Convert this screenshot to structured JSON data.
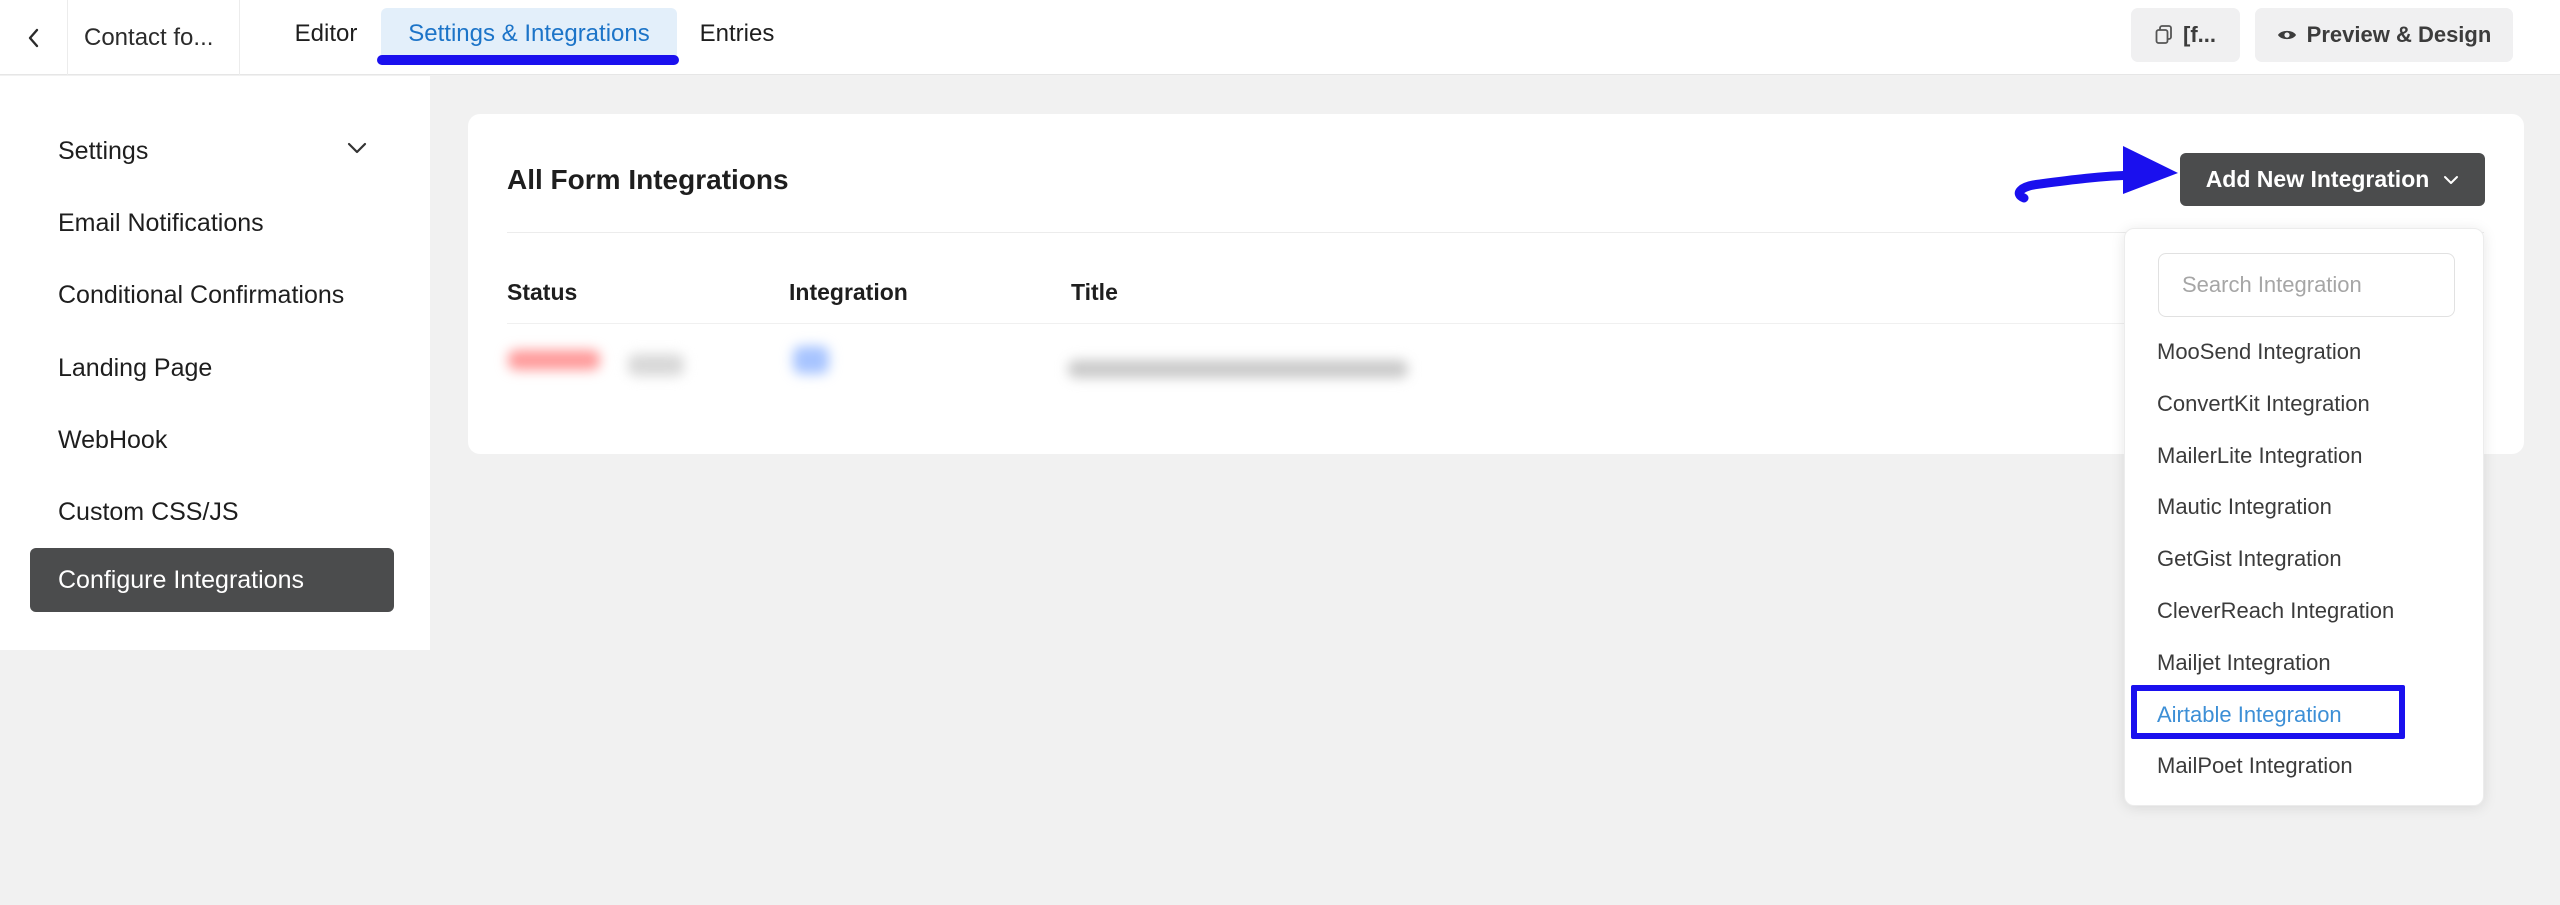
{
  "topbar": {
    "form_name": "Contact fo...",
    "tabs": [
      {
        "label": "Editor"
      },
      {
        "label": "Settings & Integrations",
        "active": true
      },
      {
        "label": "Entries"
      }
    ],
    "shortcode_label": "[f...",
    "preview_label": "Preview & Design"
  },
  "sidebar": {
    "items": [
      {
        "label": "Settings"
      },
      {
        "label": "Email Notifications"
      },
      {
        "label": "Conditional Confirmations"
      },
      {
        "label": "Landing Page"
      },
      {
        "label": "WebHook"
      },
      {
        "label": "Custom CSS/JS"
      },
      {
        "label": "Configure Integrations",
        "active": true
      }
    ]
  },
  "main": {
    "title": "All Form Integrations",
    "add_button_label": "Add New Integration",
    "columns": [
      "Status",
      "Integration",
      "Title"
    ]
  },
  "dropdown": {
    "search_placeholder": "Search Integration",
    "items": [
      "MooSend Integration",
      "ConvertKit Integration",
      "MailerLite Integration",
      "Mautic Integration",
      "GetGist Integration",
      "CleverReach Integration",
      "Mailjet Integration",
      "Airtable Integration",
      "MailPoet Integration"
    ],
    "highlighted_item": "Airtable Integration"
  },
  "colors": {
    "accent": "#1c74c8",
    "annotation": "#1a10ee",
    "dark_button": "#4b4c4d",
    "active_tab_bg": "#e3effa"
  }
}
